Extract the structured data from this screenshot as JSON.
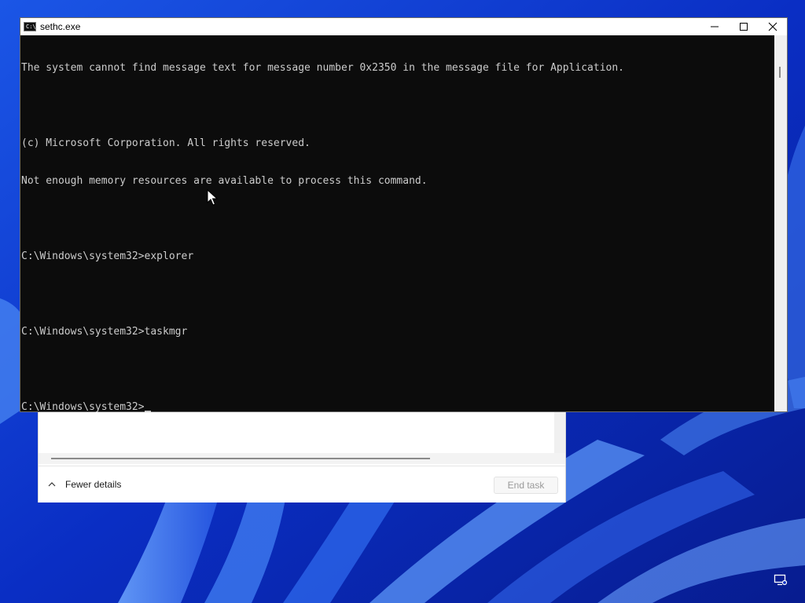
{
  "console": {
    "title": "sethc.exe",
    "icon": "cmd-icon",
    "icon_text": "C:\\",
    "lines": [
      "The system cannot find message text for message number 0x2350 in the message file for Application.",
      "",
      "(c) Microsoft Corporation. All rights reserved.",
      "Not enough memory resources are available to process this command.",
      "",
      "C:\\Windows\\system32>explorer",
      "",
      "C:\\Windows\\system32>taskmgr",
      ""
    ],
    "prompt": "C:\\Windows\\system32>",
    "controls": [
      "minimize-icon",
      "maximize-icon",
      "close-icon"
    ]
  },
  "task_manager": {
    "fewer_details_label": "Fewer details",
    "end_task_label": "End task"
  },
  "colors": {
    "wallpaper": "#0a2ec4",
    "console_bg": "#0c0c0c",
    "console_text": "#cccccc"
  }
}
